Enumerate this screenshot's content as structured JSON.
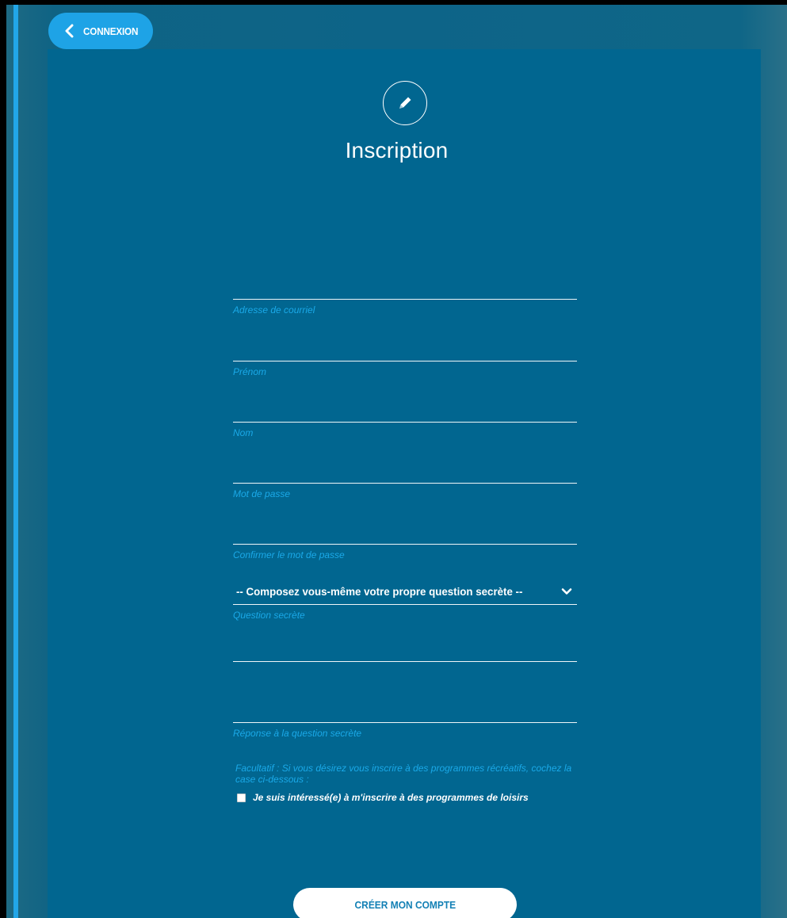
{
  "header": {
    "back_label": "CONNEXION",
    "title": "Inscription",
    "title_icon": "pencil-icon"
  },
  "form": {
    "fields": [
      {
        "caption": "Adresse de courriel",
        "value": ""
      },
      {
        "caption": "Prénom",
        "value": ""
      },
      {
        "caption": "Nom",
        "value": ""
      },
      {
        "caption": "Mot de passe",
        "value": ""
      },
      {
        "caption": "Confirmer le mot de passe",
        "value": ""
      }
    ],
    "secret_question_select": {
      "selected": "-- Composez vous-même votre propre question secrète --",
      "caption": "Question secrète"
    },
    "secret_question_custom": {
      "value": ""
    },
    "secret_answer": {
      "caption": "Réponse à la question secrète",
      "value": ""
    },
    "optional_note": "Facultatif : Si vous désirez vous inscrire à des programmes récréatifs, cochez la case ci-dessous :",
    "leisure_checkbox": {
      "label": "Je suis intéressé(e) à m'inscrire à des programmes de loisirs",
      "checked": false
    },
    "submit_label": "CRÉER MON COMPTE"
  },
  "colors": {
    "panel": "#016690",
    "accent": "#1ea3e6",
    "caption": "#1aa9e8",
    "button_text": "#1380b5"
  }
}
